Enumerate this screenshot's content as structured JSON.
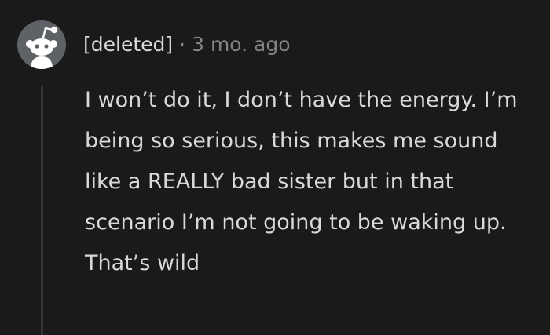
{
  "comment": {
    "author": "[deleted]",
    "separator": "·",
    "age": "3 mo. ago",
    "avatar_icon": "reddit-snoo-avatar",
    "body": "I won’t do it, I don’t have the energy. I’m being so serious, this makes me sound like a REALLY bad sister but in that scenario I’m not going to be waking up. That’s wild"
  },
  "colors": {
    "background": "#1a1a1b",
    "text": "#d7dadc",
    "muted": "#818384",
    "thread_line": "#343536",
    "avatar_bg": "#5e6266"
  }
}
